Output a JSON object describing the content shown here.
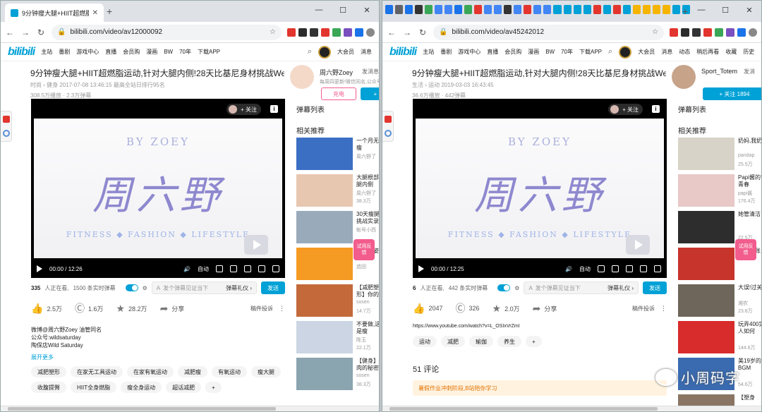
{
  "left": {
    "tab_title": "9分钟瘦大腿+HIIT超燃脂运动,",
    "url": "bilibili.com/video/av12000092",
    "nav": [
      "主站",
      "番剧",
      "游戏中心",
      "直播",
      "会员购",
      "漫画",
      "BW",
      "70年",
      "下载APP"
    ],
    "nav_badge": "上线",
    "nav_right": [
      "大会员",
      "消息",
      "动态",
      "稍后再看",
      "收藏",
      "历史"
    ],
    "video": {
      "title": "9分钟瘦大腿+HIIT超燃脂运动,针对大腿内侧!28天比基尼身材挑战Week5【...",
      "meta": "时尚 › 健身   2017-07-08 13:46:15   最高全站日排行95名",
      "stats": "308.5万播放 · 2.3万弹幕"
    },
    "up": {
      "name": "周六野Zoey",
      "msg": "发消息",
      "desc": "每周四更新!微信同名,公众号",
      "charge": "充电",
      "follow": "+ 关注"
    },
    "player": {
      "follow": "+ 关注",
      "brand_top": "BY ZOEY",
      "brand_main": "周六野",
      "tagline": "FITNESS  ◆  FASHION  ◆  LIFESTYLE",
      "time": "00:00 / 12:26",
      "auto": "自动"
    },
    "dm": {
      "watching": "335",
      "watching_label": "人正在看,",
      "loaded": "1500 条实时弹幕",
      "placeholder": "发个弹幕见证当下",
      "etiquette": "弹幕礼仪 ›",
      "send": "发送"
    },
    "actions": {
      "like": "2.5万",
      "coin": "1.6万",
      "fav": "28.2万",
      "share": "分享",
      "report": "稿件投诉"
    },
    "desc": [
      "微博@周六野Zoey 油管同名",
      "公众号:wildsaturday",
      "陶保店Wild Saturday"
    ],
    "expand": "展开更多",
    "tags": [
      "减肥塑形",
      "在家无工具运动",
      "在家有氧运动",
      "减肥瘦",
      "有氧运动",
      "瘦大腿",
      "收腹提臀",
      "HIIT全身燃脂",
      "瘦全身运动",
      "超话减肥"
    ],
    "side": {
      "danmaku": "弹幕列表",
      "related": "相关推荐"
    },
    "recs": [
      {
        "title": "一个月无痕瘦",
        "author": "周六野了",
        "stat": "",
        "color": "#3b6fc4"
      },
      {
        "title": "大腿根部大腿内侧",
        "author": "周六野了",
        "stat": "38.3万",
        "color": "#e8c7b0"
      },
      {
        "title": "30天瘦腿挑战实录",
        "author": "帐号小西",
        "stat": "",
        "color": "#9ab"
      },
      {
        "title": "正确睡姿",
        "author": "追回",
        "stat": "",
        "color": "#f59a23"
      },
      {
        "title": "【减肥塑形】你的五分",
        "author": "sosen",
        "stat": "14.7万",
        "color": "#c46a3a"
      },
      {
        "title": "不要做,这是瘦",
        "author": "陈玉",
        "stat": "22.1万",
        "color": "#cbd5e3"
      },
      {
        "title": "【健身】肌肉的秘密",
        "author": "sosen",
        "stat": "38.3万",
        "color": "#8aa4b0"
      }
    ],
    "feedback": "试用反馈"
  },
  "right": {
    "url": "bilibili.com/video/av45242012",
    "nav": [
      "主站",
      "番剧",
      "游戏中心",
      "直播",
      "会员购",
      "漫画",
      "BW",
      "70年",
      "下载APP"
    ],
    "nav_badge": "2",
    "nav_right": [
      "大会员",
      "消息",
      "动态",
      "稍后再看",
      "收藏",
      "历史"
    ],
    "video": {
      "title": "9分钟瘦大腿+HIIT超燃脂运动,针对大腿内侧!28天比基尼身材挑战Week5【...",
      "meta": "生活 › 运动   2019-03-03 16:43:45",
      "stats": "36.6万播放 · 442弹幕"
    },
    "up": {
      "name": "Sport_Totem",
      "msg": "发消",
      "follow": "+ 关注 1894"
    },
    "player": {
      "follow": "+ 关注",
      "brand_top": "BY ZOEY",
      "brand_main": "周六野",
      "tagline": "FITNESS  ◆  FASHION  ◆  LIFESTYLE",
      "time": "00:00 / 12:25",
      "auto": "自动"
    },
    "dm": {
      "watching": "6",
      "watching_label": "人正在看,",
      "loaded": "442 条实时弹幕",
      "placeholder": "发个弹幕见证当下",
      "etiquette": "弹幕礼仪 ›",
      "send": "发送"
    },
    "actions": {
      "like": "2047",
      "coin": "326",
      "fav": "2.0万",
      "share": "分享",
      "report": "稿件投诉"
    },
    "url_text": "https://www.youtube.com/watch?v=L_OSIxVrZmI",
    "tags": [
      "运动",
      "减肥",
      "瑜伽",
      "养生"
    ],
    "comments": "51  评论",
    "notice": "暑假作业冲刺阶段,B站陪你学习",
    "side": {
      "danmaku": "弹幕列表",
      "related": "相关推荐"
    },
    "recs": [
      {
        "title": "奶妈,我奶!",
        "author": "pandap",
        "stat": "25.5万",
        "color": "#d8d3c8"
      },
      {
        "title": "Papi酱的钟青春",
        "author": "papi酱",
        "stat": "176.4万",
        "color": "#e9c8c8"
      },
      {
        "title": "她管清洁",
        "author": "",
        "stat": "22.5万",
        "color": "#2d2d2d"
      },
      {
        "title": "追回旧账",
        "author": "",
        "stat": "",
        "color": "#c7342c"
      },
      {
        "title": "大误!过关",
        "author": "湘农",
        "stat": "23.8万",
        "color": "#6e665a"
      },
      {
        "title": "玩弄400实人如何",
        "author": "",
        "stat": "144.6万",
        "color": "#d82b2b"
      },
      {
        "title": "美19岁的BGM",
        "author": "",
        "stat": "54.6万",
        "color": "#3a6bb0"
      },
      {
        "title": "【塑身",
        "author": "",
        "stat": "",
        "color": "#8a7565"
      }
    ],
    "feedback": "试用反馈",
    "watermark": "小周码字"
  }
}
